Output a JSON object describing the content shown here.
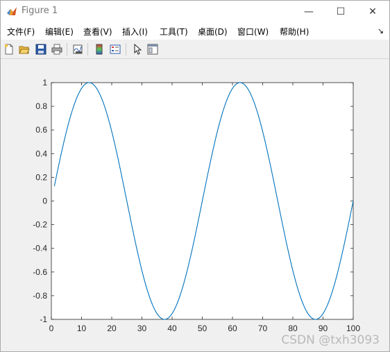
{
  "window": {
    "title": "Figure 1",
    "controls": {
      "minimize": "—",
      "maximize": "☐",
      "close": "✕"
    }
  },
  "menu": {
    "items": [
      {
        "label": "文件(F)"
      },
      {
        "label": "编辑(E)"
      },
      {
        "label": "查看(V)"
      },
      {
        "label": "插入(I)"
      },
      {
        "label": "工具(T)"
      },
      {
        "label": "桌面(D)"
      },
      {
        "label": "窗口(W)"
      },
      {
        "label": "帮助(H)"
      }
    ],
    "overflow_icon": "↘"
  },
  "toolbar": {
    "buttons": [
      "new-figure-icon",
      "open-file-icon",
      "save-icon",
      "print-icon",
      "link-plot-icon",
      "colorbar-icon",
      "legend-icon",
      "pointer-icon",
      "property-editor-icon"
    ]
  },
  "watermark": "CSDN @txh3093",
  "colors": {
    "line": "#0072bd",
    "axes_bg": "#ffffff",
    "figure_bg": "#f0f0f0",
    "axis": "#262626"
  },
  "chart_data": {
    "type": "line",
    "function": "y = sin(2*pi*x/50)",
    "x_range": [
      1,
      100
    ],
    "xlim": [
      0,
      100
    ],
    "ylim": [
      -1,
      1
    ],
    "x_ticks": [
      "0",
      "10",
      "20",
      "30",
      "40",
      "50",
      "60",
      "70",
      "80",
      "90",
      "100"
    ],
    "y_ticks": [
      "-1",
      "-0.8",
      "-0.6",
      "-0.4",
      "-0.2",
      "0",
      "0.2",
      "0.4",
      "0.6",
      "0.8",
      "1"
    ],
    "series": [
      {
        "x": [
          1,
          5,
          10,
          12.5,
          15,
          20,
          25,
          30,
          35,
          37.5,
          40,
          45,
          50,
          55,
          60,
          62.5,
          65,
          70,
          75,
          80,
          85,
          87.5,
          90,
          95,
          100
        ],
        "y": [
          0.125,
          0.588,
          0.951,
          1,
          0.951,
          0.588,
          0,
          -0.588,
          -0.951,
          -1,
          -0.951,
          -0.588,
          0,
          0.588,
          0.951,
          1,
          0.951,
          0.588,
          0,
          -0.588,
          -0.951,
          -1,
          -0.951,
          -0.588,
          0
        ]
      }
    ],
    "grid": false,
    "legend": false
  }
}
